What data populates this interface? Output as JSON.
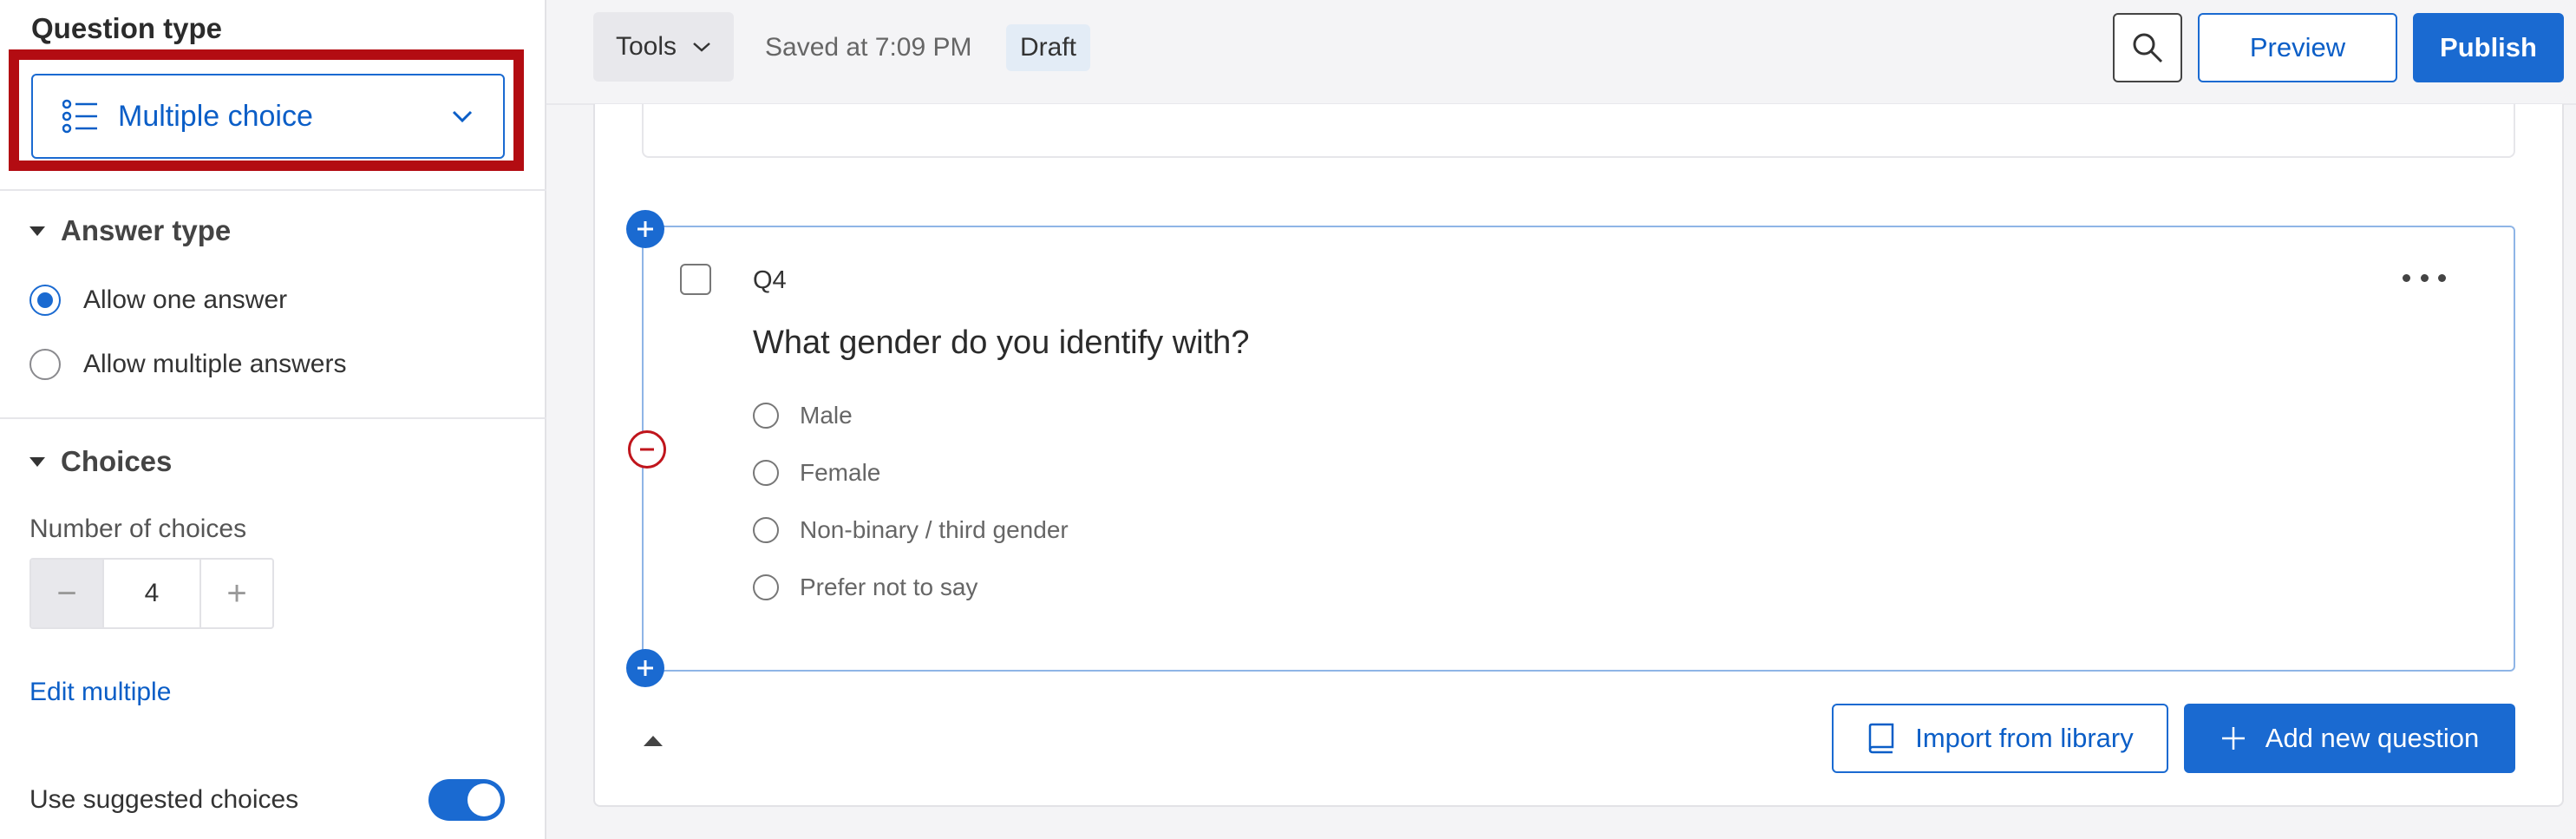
{
  "sidebar": {
    "question_type_heading": "Question type",
    "question_type_value": "Multiple choice",
    "answer_type": {
      "heading": "Answer type",
      "options": [
        {
          "label": "Allow one answer",
          "selected": true
        },
        {
          "label": "Allow multiple answers",
          "selected": false
        }
      ]
    },
    "choices": {
      "heading": "Choices",
      "number_label": "Number of choices",
      "number_value": "4",
      "minus": "−",
      "plus": "+",
      "edit_multiple": "Edit multiple"
    },
    "suggested_choices": {
      "label": "Use suggested choices",
      "enabled": true
    }
  },
  "toolbar": {
    "tools_label": "Tools",
    "saved_text": "Saved at 7:09 PM",
    "draft_badge": "Draft",
    "preview_label": "Preview",
    "publish_label": "Publish"
  },
  "question": {
    "number": "Q4",
    "text": "What gender do you identify with?",
    "choices": [
      "Male",
      "Female",
      "Non-binary / third gender",
      "Prefer not to say"
    ]
  },
  "actions": {
    "import_label": "Import from library",
    "add_label": "Add new question"
  },
  "colors": {
    "accent": "#1a6ad1",
    "highlight": "#b30c12",
    "remove": "#c0151c"
  },
  "icons": [
    "list-icon",
    "chevron-down-icon",
    "search-icon",
    "add-icon",
    "remove-icon",
    "more-options-icon",
    "book-icon",
    "plus-icon",
    "collapse-icon"
  ]
}
